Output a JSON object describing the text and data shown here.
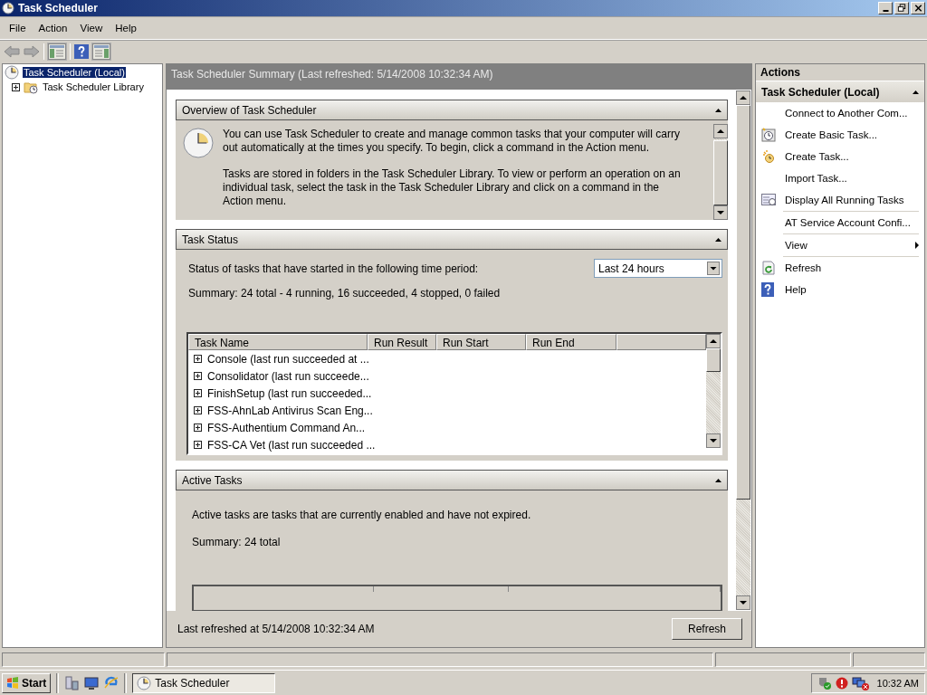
{
  "window": {
    "title": "Task Scheduler"
  },
  "menu": [
    "File",
    "Action",
    "View",
    "Help"
  ],
  "tree": [
    {
      "label": "Task Scheduler (Local)",
      "selected": true,
      "children": [
        {
          "label": "Task Scheduler Library",
          "selected": false,
          "expanded": false
        }
      ]
    }
  ],
  "summary": {
    "header": "Task Scheduler Summary (Last refreshed: 5/14/2008 10:32:34 AM)",
    "overview": {
      "title": "Overview of Task Scheduler",
      "expanded": true,
      "paragraphs": [
        "You can use Task Scheduler to create and manage common tasks that your computer will carry out automatically at the times you specify. To begin, click a command in the Action menu.",
        "Tasks are stored in folders in the Task Scheduler Library. To view or perform an operation on an individual task, select the task in the Task Scheduler Library and click on a command in the Action menu."
      ]
    },
    "task_status": {
      "title": "Task Status",
      "expanded": true,
      "prompt": "Status of tasks that have started in the following time period:",
      "period": "Last 24 hours",
      "summary": "Summary: 24 total - 4 running, 16 succeeded, 4 stopped, 0 failed",
      "columns": [
        "Task Name",
        "Run Result",
        "Run Start",
        "Run End"
      ],
      "rows": [
        {
          "name": "Console (last run succeeded at ...",
          "expanded": false
        },
        {
          "name": "Consolidator (last run succeede...",
          "expanded": false
        },
        {
          "name": "FinishSetup (last run succeeded...",
          "expanded": false
        },
        {
          "name": "FSS-AhnLab Antivirus Scan Eng...",
          "expanded": false
        },
        {
          "name": "FSS-Authentium Command An...",
          "expanded": false
        },
        {
          "name": "FSS-CA Vet (last run succeeded ...",
          "expanded": false
        }
      ]
    },
    "active_tasks": {
      "title": "Active Tasks",
      "expanded": true,
      "text": "Active tasks are tasks that are currently enabled and have not expired.",
      "summary": "Summary: 24 total"
    },
    "footer": {
      "text": "Last refreshed at 5/14/2008 10:32:34 AM",
      "button": "Refresh"
    }
  },
  "actions": {
    "title": "Actions",
    "group": "Task Scheduler (Local)",
    "group_expanded": true,
    "items": [
      {
        "label": "Connect to Another Com...",
        "kind": "command",
        "divider_before": false
      },
      {
        "label": "Create Basic Task...",
        "kind": "command",
        "divider_before": false
      },
      {
        "label": "Create Task...",
        "kind": "command",
        "divider_before": false
      },
      {
        "label": "Import Task...",
        "kind": "command",
        "divider_before": false
      },
      {
        "label": "Display All Running Tasks",
        "kind": "command",
        "divider_before": false
      },
      {
        "label": "AT Service Account Confi...",
        "kind": "command",
        "divider_before": true
      },
      {
        "label": "View",
        "kind": "submenu",
        "divider_before": true
      },
      {
        "label": "Refresh",
        "kind": "command",
        "divider_before": true
      },
      {
        "label": "Help",
        "kind": "command",
        "divider_before": false
      }
    ]
  },
  "taskbar": {
    "start": "Start",
    "tasks": [
      {
        "label": "Task Scheduler",
        "selected": true
      }
    ],
    "clock": "10:32 AM"
  }
}
